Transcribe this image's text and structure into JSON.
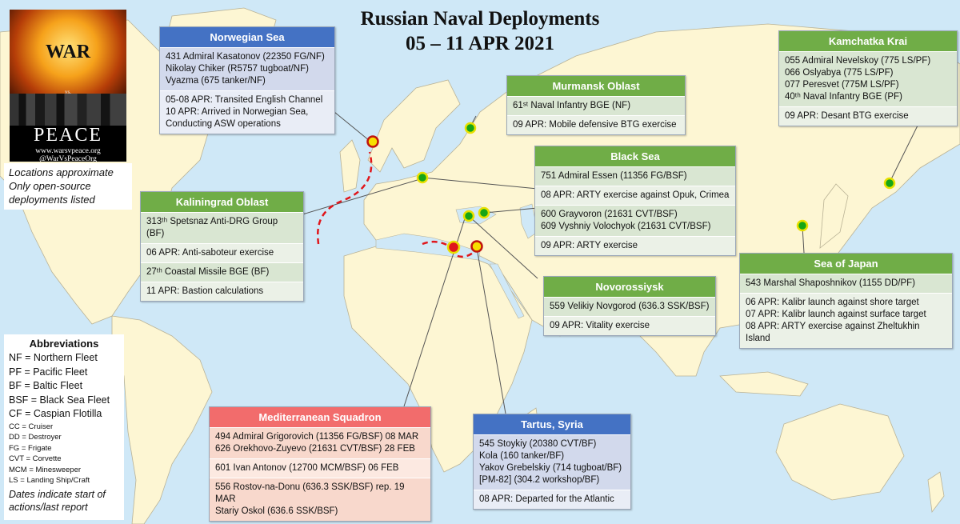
{
  "title": {
    "line1": "Russian Naval Deployments",
    "line2": "05 – 11 APR 2021"
  },
  "logo": {
    "war": "WAR",
    "vs": "vs.",
    "peace": "PEACE",
    "url": "www.warsvpeace.org",
    "handle": "@WarVsPeaceOrg"
  },
  "note": {
    "line1": "Locations approximate",
    "line2": "Only open-source",
    "line3": "deployments listed"
  },
  "abbreviations": {
    "heading": "Abbreviations",
    "main": [
      "NF = Northern Fleet",
      "PF = Pacific Fleet",
      "BF = Baltic Fleet",
      "BSF = Black Sea Fleet",
      "CF = Caspian Flotilla"
    ],
    "minor": [
      "CC = Cruiser",
      "DD = Destroyer",
      "FG = Frigate",
      "CVT = Corvette",
      "MCM = Minesweeper",
      "LS = Landing Ship/Craft"
    ],
    "footer": "Dates indicate start of actions/last report"
  },
  "panels": {
    "norwegian": {
      "title": "Norwegian Sea",
      "rows": [
        [
          "431 Admiral Kasatonov (22350 FG/NF)",
          "Nikolay Chiker (R5757 tugboat/NF)",
          "Vyazma (675 tanker/NF)"
        ],
        [
          "05-08 APR: Transited English Channel",
          "10 APR: Arrived in Norwegian Sea,",
          "Conducting ASW operations"
        ]
      ]
    },
    "murmansk": {
      "title": "Murmansk Oblast",
      "rows": [
        [
          "61ˢᵗ Naval Infantry BGE (NF)"
        ],
        [
          "09 APR: Mobile defensive BTG exercise"
        ]
      ]
    },
    "kamchatka": {
      "title": "Kamchatka Krai",
      "rows": [
        [
          "055 Admiral Nevelskoy (775 LS/PF)",
          "066 Oslyabya (775 LS/PF)",
          "077 Peresvet (775M LS/PF)",
          "40ᵗʰ Naval Infantry BGE (PF)"
        ],
        [
          "09 APR: Desant BTG exercise"
        ]
      ]
    },
    "blacksea": {
      "title": "Black Sea",
      "rows": [
        [
          "751 Admiral Essen (11356 FG/BSF)"
        ],
        [
          "08 APR: ARTY exercise against Opuk, Crimea"
        ],
        [
          "600 Grayvoron (21631 CVT/BSF)",
          "609 Vyshniy Volochyok (21631 CVT/BSF)"
        ],
        [
          "09 APR: ARTY exercise"
        ]
      ]
    },
    "kaliningrad": {
      "title": "Kaliningrad Oblast",
      "rows": [
        [
          "313ᵗʰ Spetsnaz Anti-DRG Group (BF)"
        ],
        [
          "06 APR: Anti-saboteur exercise"
        ],
        [
          "27ᵗʰ Coastal Missile BGE (BF)"
        ],
        [
          "11 APR: Bastion calculations"
        ]
      ]
    },
    "japan": {
      "title": "Sea of Japan",
      "rows": [
        [
          "543 Marshal Shaposhnikov (1155 DD/PF)"
        ],
        [
          "06 APR: Kalibr launch against shore target",
          "07 APR: Kalibr launch against surface target",
          "08 APR: ARTY exercise against Zheltukhin Island"
        ]
      ]
    },
    "novorossiysk": {
      "title": "Novorossiysk",
      "rows": [
        [
          "559 Velikiy Novgorod (636.3 SSK/BSF)"
        ],
        [
          "09 APR: Vitality exercise"
        ]
      ]
    },
    "mediterranean": {
      "title": "Mediterranean Squadron",
      "rows": [
        [
          "494 Admiral Grigorovich (11356 FG/BSF) 08 MAR",
          "626 Orekhovo-Zuyevo (21631 CVT/BSF) 28 FEB"
        ],
        [
          "601 Ivan Antonov (12700 MCM/BSF) 06 FEB"
        ],
        [
          "556 Rostov-na-Donu (636.3 SSK/BSF) rep. 19 MAR",
          "Stariy Oskol (636.6 SSK/BSF)"
        ]
      ]
    },
    "tartus": {
      "title": "Tartus, Syria",
      "rows": [
        [
          "545 Stoykiy (20380 CVT/BF)",
          "Kola (160 tanker/BF)",
          "Yakov Grebelskiy (714 tugboat/BF)",
          "[PM-82] (304.2 workshop/BF)"
        ],
        [
          "08 APR: Departed for the Atlantic"
        ]
      ]
    }
  },
  "colors": {
    "sea": "#cfe8f7",
    "land": "#fdf6d3",
    "green_header": "#70ad47",
    "blue_header": "#4472c4",
    "red_header": "#f26c6c",
    "route": "#e0161b"
  }
}
